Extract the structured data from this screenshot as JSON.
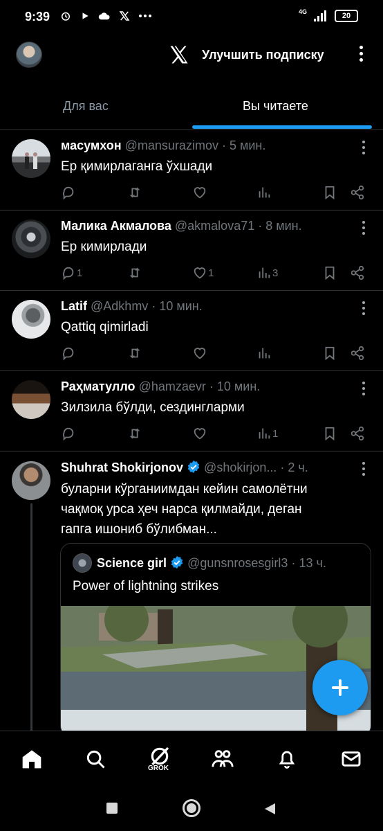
{
  "status_bar": {
    "time": "9:39",
    "network": "4G",
    "battery": "20"
  },
  "header": {
    "upgrade_label": "Улучшить подписку",
    "icons": [
      "avatar",
      "x-logo-icon",
      "more-vert-icon"
    ]
  },
  "tabs": [
    {
      "label": "Для вас",
      "active": false
    },
    {
      "label": "Вы читаете",
      "active": true
    }
  ],
  "tweets": [
    {
      "name": "масумхон",
      "handle": "@mansurazimov",
      "time": "· 5 мин.",
      "text": "Ер қимирлаганга ўхшади",
      "replies": "",
      "reposts": "",
      "likes": "",
      "views": ""
    },
    {
      "name": "Малика Акмалова",
      "handle": "@akmalova71",
      "time": "· 8 мин.",
      "text": "Ер кимирлади",
      "replies": "1",
      "reposts": "",
      "likes": "1",
      "views": "3"
    },
    {
      "name": "Latif",
      "handle": "@Adkhmv",
      "time": "· 10 мин.",
      "text": "Qattiq qimirladi",
      "replies": "",
      "reposts": "",
      "likes": "",
      "views": ""
    },
    {
      "name": "Раҳматулло",
      "handle": "@hamzaevr",
      "time": "· 10 мин.",
      "text": "Зилзила бўлди, сездингларми",
      "replies": "",
      "reposts": "",
      "likes": "",
      "views": "1"
    },
    {
      "name": "Shuhrat Shokirjonov",
      "handle": "@shokirjon...",
      "time": "· 2 ч.",
      "verified": true,
      "text_lines": [
        "буларни кўрганиимдан кейин самолётни",
        "чақмоқ урса ҳеч нарса қилмайди, деган",
        "гапга ишониб бўлибман..."
      ],
      "quote": {
        "name": "Science girl",
        "handle": "@gunsnrosesgirl3",
        "time": "· 13 ч.",
        "verified": true,
        "text": "Power of lightning strikes"
      }
    }
  ],
  "bottom_nav": [
    {
      "name": "home-icon",
      "active": true
    },
    {
      "name": "search-icon"
    },
    {
      "name": "grok-icon",
      "label": "GROK"
    },
    {
      "name": "communities-icon"
    },
    {
      "name": "notifications-icon"
    },
    {
      "name": "messages-icon"
    }
  ],
  "colors": {
    "background": "#000000",
    "accent": "#1d9bf0",
    "muted": "#71767b",
    "divider": "#2f3336"
  }
}
